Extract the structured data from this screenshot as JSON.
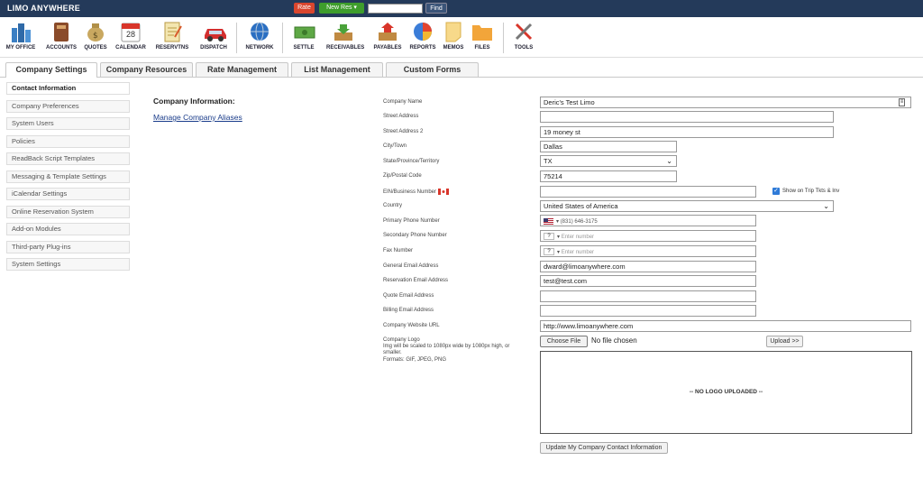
{
  "header": {
    "app_name": "LIMO ANYWHERE",
    "rate_label": "Rate",
    "new_res_label": "New Res",
    "find_label": "Find",
    "search_value": ""
  },
  "toolbar": [
    {
      "label": "MY OFFICE",
      "icon": "office-icon"
    },
    {
      "label": "ACCOUNTS",
      "icon": "book-icon"
    },
    {
      "label": "QUOTES",
      "icon": "money-bag-icon"
    },
    {
      "label": "CALENDAR",
      "icon": "calendar-icon",
      "day": "28"
    },
    {
      "label": "RESERVTNS",
      "icon": "notepad-icon"
    },
    {
      "label": "DISPATCH",
      "icon": "car-icon"
    },
    {
      "label": "NETWORK",
      "icon": "globe-icon"
    },
    {
      "label": "SETTLE",
      "icon": "cash-icon"
    },
    {
      "label": "RECEIVABLES",
      "icon": "inbox-icon"
    },
    {
      "label": "PAYABLES",
      "icon": "outbox-icon"
    },
    {
      "label": "REPORTS",
      "icon": "pie-chart-icon"
    },
    {
      "label": "MEMOS",
      "icon": "memo-icon"
    },
    {
      "label": "FILES",
      "icon": "folder-icon"
    },
    {
      "label": "TOOLS",
      "icon": "tools-icon"
    }
  ],
  "tabs": [
    {
      "label": "Company Settings",
      "active": true
    },
    {
      "label": "Company Resources"
    },
    {
      "label": "Rate Management"
    },
    {
      "label": "List Management"
    },
    {
      "label": "Custom Forms"
    }
  ],
  "sidebar": [
    {
      "label": "Contact Information",
      "active": true
    },
    {
      "label": "Company Preferences"
    },
    {
      "label": "System Users"
    },
    {
      "label": "Policies"
    },
    {
      "label": "ReadBack Script Templates"
    },
    {
      "label": "Messaging & Template Settings"
    },
    {
      "label": "iCalendar Settings"
    },
    {
      "label": "Online Reservation System"
    },
    {
      "label": "Add-on Modules"
    },
    {
      "label": "Third-party Plug-ins"
    },
    {
      "label": "System Settings"
    }
  ],
  "main": {
    "heading": "Company Information:",
    "aliases_link": "Manage Company Aliases",
    "fields": {
      "company_name": {
        "label": "Company Name",
        "value": "Deric's Test Limo"
      },
      "street": {
        "label": "Street Address",
        "value": ""
      },
      "street2": {
        "label": "Street Address 2",
        "value": "19 money st"
      },
      "city": {
        "label": "City/Town",
        "value": "Dallas"
      },
      "state": {
        "label": "State/Province/Territory",
        "value": "TX"
      },
      "zip": {
        "label": "Zip/Postal Code",
        "value": "75214"
      },
      "ein": {
        "label": "EIN/Business Number",
        "value": ""
      },
      "show_on_trip": {
        "label": "Show on Trip Tkts & Inv",
        "checked": true
      },
      "country": {
        "label": "Country",
        "value": "United States of America"
      },
      "primary_phone": {
        "label": "Primary Phone Number",
        "value": "(831) 646-3175"
      },
      "secondary_phone": {
        "label": "Secondary Phone Number",
        "placeholder": "Enter number"
      },
      "fax": {
        "label": "Fax Number",
        "placeholder": "Enter number"
      },
      "general_email": {
        "label": "General Email Address",
        "value": "dward@limoanywhere.com"
      },
      "reservation_email": {
        "label": "Reservation Email Address",
        "value": "test@test.com"
      },
      "quote_email": {
        "label": "Quote Email Address",
        "value": ""
      },
      "billing_email": {
        "label": "Billing Email Address",
        "value": ""
      },
      "website": {
        "label": "Company Website URL",
        "value": "http://www.limoanywhere.com"
      }
    },
    "logo": {
      "label": "Company Logo",
      "note": "Img will be scaled to 1080px wide by 1080px high, or smaller.",
      "formats": "Formats: GIF, JPEG, PNG",
      "choose_label": "Choose File",
      "no_file": "No file chosen",
      "upload_label": "Upload >>",
      "placeholder": "-- NO LOGO UPLOADED --"
    },
    "update_button": "Update My Company Contact Information"
  },
  "colors": {
    "header_bg": "#243a5a",
    "rate_btn": "#d9462e",
    "newres_btn": "#3e9d2c",
    "link": "#1a3c8a"
  }
}
